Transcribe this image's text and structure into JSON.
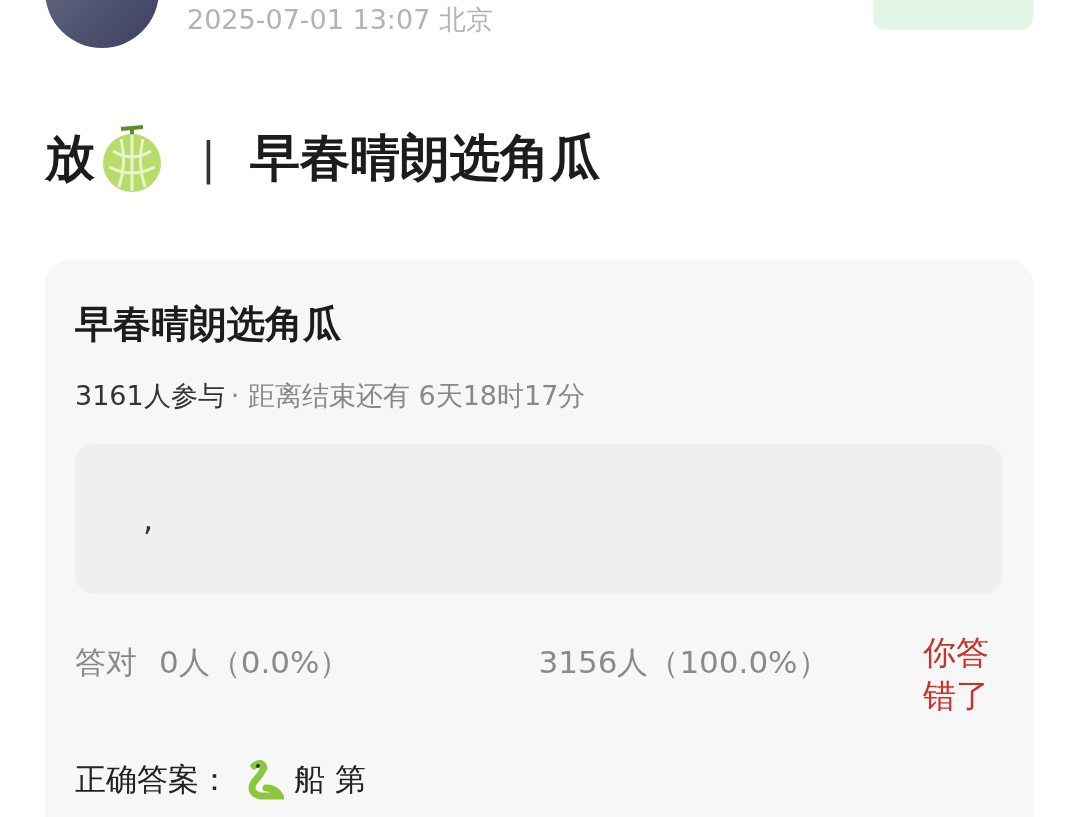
{
  "post_header": {
    "timestamp": "2025-07-01 13:07",
    "location": "北京"
  },
  "post_title": {
    "prefix": "放",
    "separator": "|",
    "text": "早春晴朗选角瓜"
  },
  "quiz_card": {
    "title": "早春晴朗选角瓜",
    "participants": "3161人参与",
    "countdown": "· 距离结束还有 6天18时17分",
    "option": {
      "text": ","
    },
    "stats": {
      "correct_label": "答对",
      "correct_count": "0人（0.0%）",
      "wrong_count": "3156人（100.0%）",
      "result": "你答错了",
      "answered_correctly": false
    },
    "answer": {
      "label": "正确答案：",
      "text": "船 第"
    }
  }
}
